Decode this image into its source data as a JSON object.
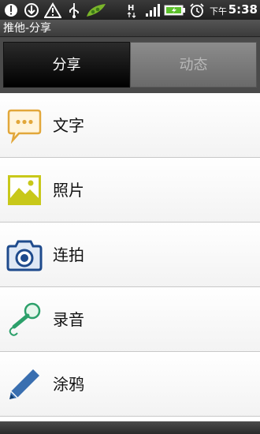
{
  "status_bar": {
    "time": "5:38",
    "ampm": "下午",
    "signal_type": "H",
    "icons": [
      "notification-icon",
      "download-icon",
      "warning-icon",
      "usb-icon",
      "app-icon",
      "h-network-icon",
      "signal-icon",
      "battery-icon",
      "alarm-icon"
    ]
  },
  "title_bar": {
    "title": "推他-分享"
  },
  "tabs": [
    {
      "label": "分享",
      "active": true
    },
    {
      "label": "动态",
      "active": false
    }
  ],
  "list": [
    {
      "label": "文字",
      "icon": "text-bubble-icon"
    },
    {
      "label": "照片",
      "icon": "photo-icon"
    },
    {
      "label": "连拍",
      "icon": "camera-icon"
    },
    {
      "label": "录音",
      "icon": "microphone-icon"
    },
    {
      "label": "涂鸦",
      "icon": "pencil-icon"
    }
  ],
  "colors": {
    "text_icon": "#e2a73a",
    "photo_icon": "#c8c81a",
    "camera_icon": "#1e4a8c",
    "mic_icon": "#2ca06a",
    "pencil_icon": "#3a6fb0"
  }
}
